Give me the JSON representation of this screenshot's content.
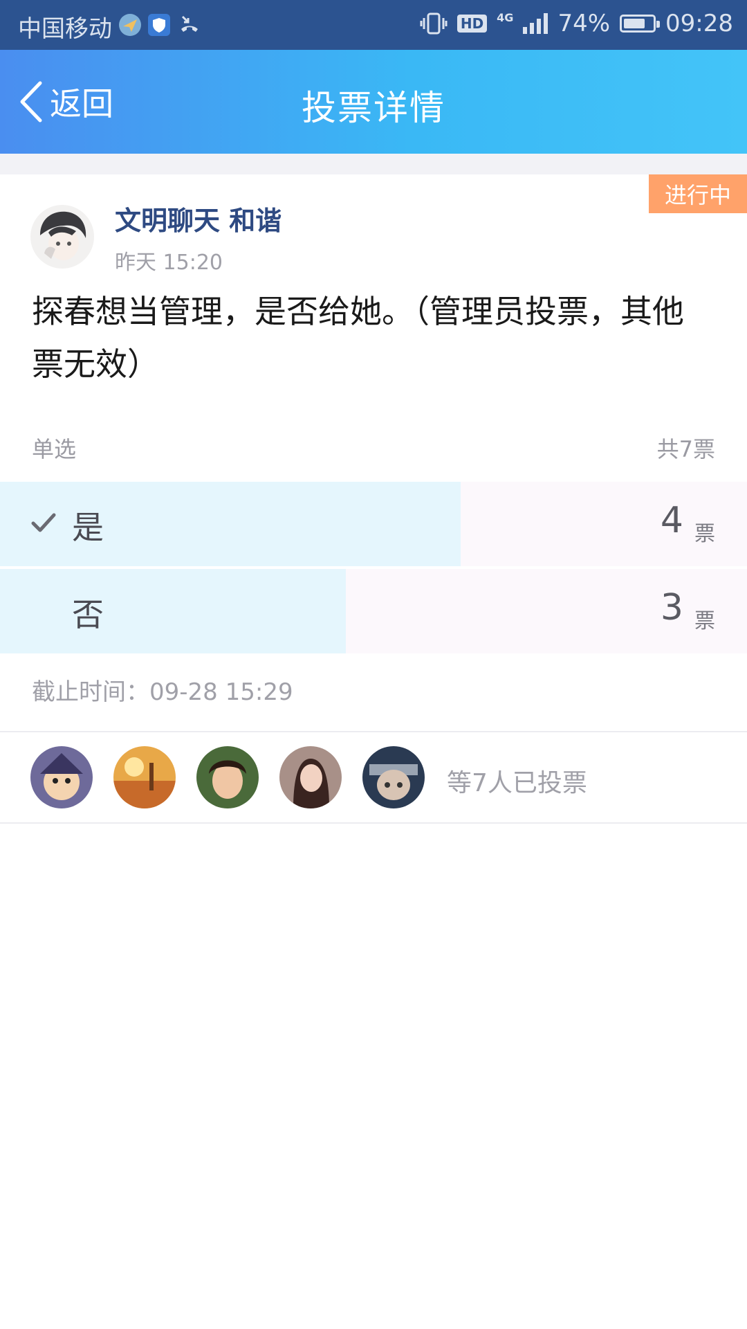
{
  "status_bar": {
    "carrier": "中国移动",
    "hd": "HD",
    "network": "4G",
    "battery": "74%",
    "battery_level": 0.74,
    "time": "09:28"
  },
  "nav": {
    "back_label": "返回",
    "title": "投票详情"
  },
  "vote": {
    "status": "进行中",
    "author": "文明聊天 和谐",
    "posted_at": "昨天 15:20",
    "question": "探春想当管理，是否给她。（管理员投票，其他票无效）",
    "mode": "单选",
    "total": "共7票",
    "options": [
      {
        "label": "是",
        "count": "4",
        "unit": "票",
        "share": 0.571,
        "selected": true
      },
      {
        "label": "否",
        "count": "3",
        "unit": "票",
        "share": 0.429,
        "selected": false
      }
    ],
    "deadline": "截止时间：09-28 15:29",
    "voters_text": "等7人已投票"
  },
  "colors": {
    "nav_start": "#4a8ef0",
    "nav_end": "#43c4f8",
    "status_badge": "#ffa26a",
    "author": "#2e4a82",
    "option_bar": "#e5f6fd"
  }
}
